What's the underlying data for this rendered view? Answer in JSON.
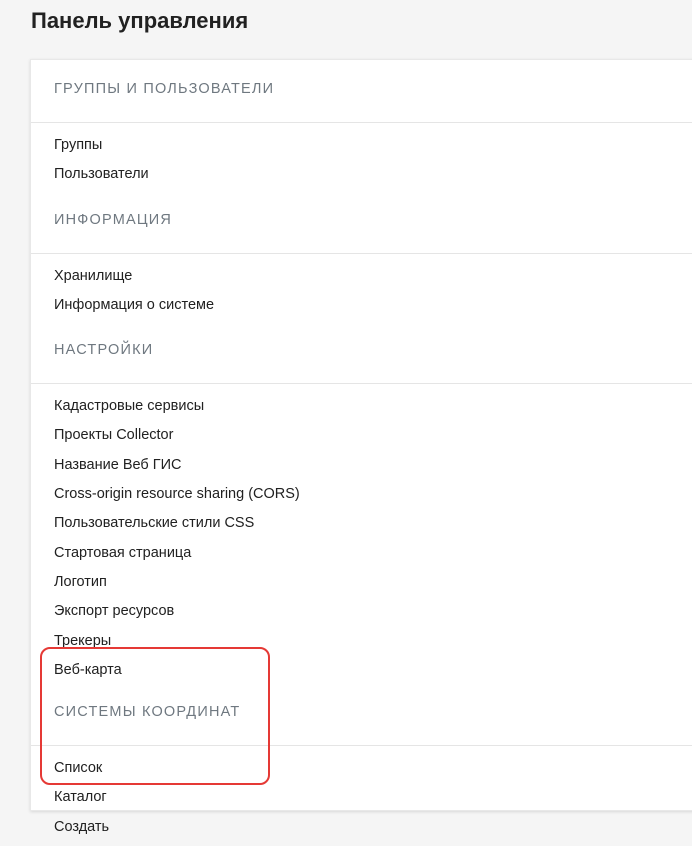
{
  "page": {
    "title": "Панель управления"
  },
  "sections": [
    {
      "header": "ГРУППЫ И ПОЛЬЗОВАТЕЛИ",
      "items": [
        "Группы",
        "Пользователи"
      ]
    },
    {
      "header": "ИНФОРМАЦИЯ",
      "items": [
        "Хранилище",
        "Информация о системе"
      ]
    },
    {
      "header": "НАСТРОЙКИ",
      "items": [
        "Кадастровые сервисы",
        "Проекты Collector",
        "Название Веб ГИС",
        "Cross-origin resource sharing (CORS)",
        "Пользовательские стили CSS",
        "Стартовая страница",
        "Логотип",
        "Экспорт ресурсов",
        "Трекеры",
        "Веб-карта"
      ]
    },
    {
      "header": "СИСТЕМЫ КООРДИНАТ",
      "items": [
        "Список",
        "Каталог",
        "Создать"
      ]
    }
  ],
  "colors": {
    "highlight": "#e53935",
    "header_text": "#6f7880",
    "item_text": "#212121"
  }
}
